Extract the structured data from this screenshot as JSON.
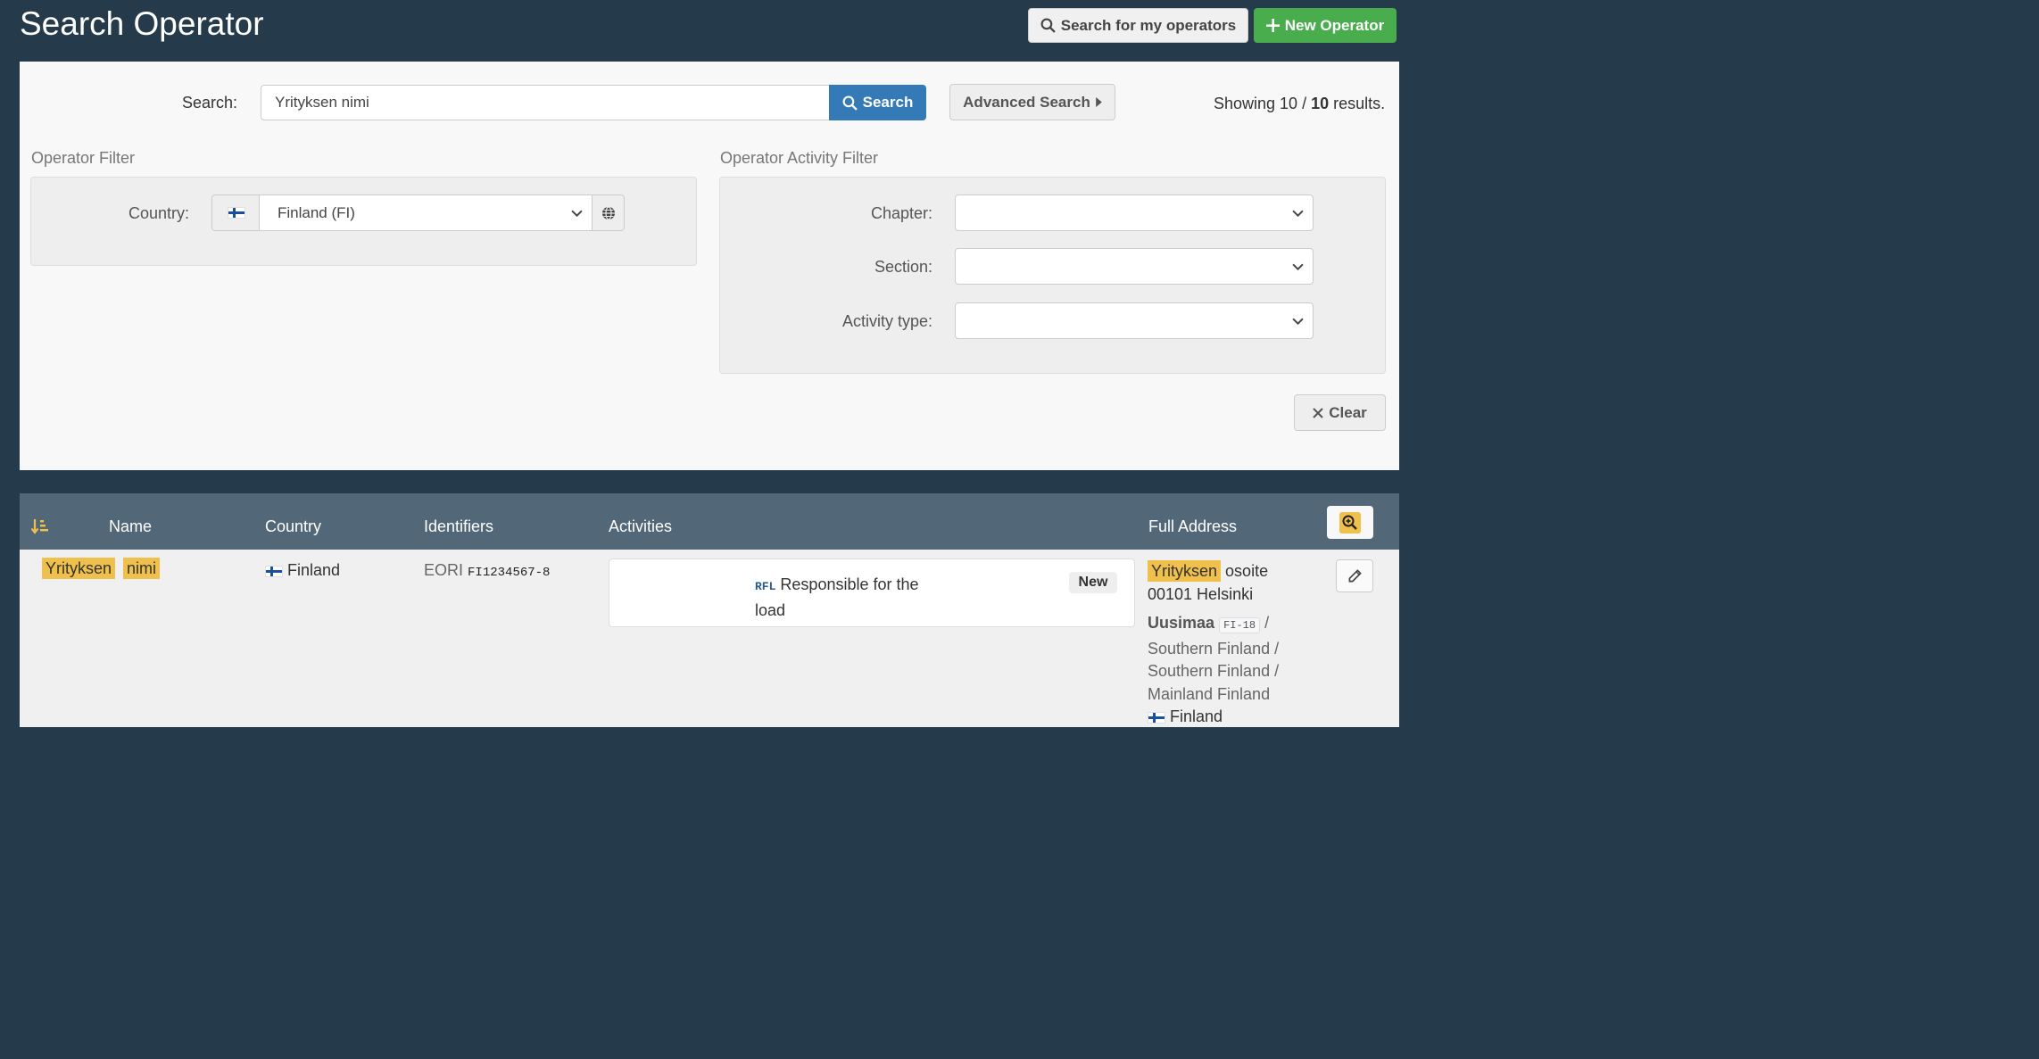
{
  "header": {
    "title": "Search Operator",
    "my_operators_label": "Search for my operators",
    "new_operator_label": "New Operator"
  },
  "search": {
    "label": "Search:",
    "value": "Yrityksen nimi",
    "button_label": "Search",
    "advanced_label": "Advanced Search",
    "results_prefix": "Showing 10 / ",
    "results_total": "10",
    "results_suffix": " results."
  },
  "operator_filter": {
    "title": "Operator Filter",
    "country_label": "Country:",
    "country_value": "Finland (FI)"
  },
  "activity_filter": {
    "title": "Operator Activity Filter",
    "chapter_label": "Chapter:",
    "section_label": "Section:",
    "activity_type_label": "Activity type:",
    "chapter_value": "",
    "section_value": "",
    "activity_type_value": ""
  },
  "clear_label": "Clear",
  "table": {
    "headers": {
      "name": "Name",
      "country": "Country",
      "identifiers": "Identifiers",
      "activities": "Activities",
      "address": "Full Address"
    },
    "rows": [
      {
        "name_part1": "Yrityksen",
        "name_part2": "nimi",
        "country": "Finland",
        "identifier_type": "EORI",
        "identifier_value": "FI1234567-8",
        "activity_code": "RFL",
        "activity_line1": "Responsible for the",
        "activity_line2": "load",
        "activity_badge": "New",
        "address_hl": "Yrityksen",
        "address_rest": "osoite",
        "address_line2": "00101 Helsinki",
        "region_name": "Uusimaa",
        "region_code": "FI-18",
        "region_sep": "/",
        "region_line2": "Southern Finland /",
        "region_line3": "Southern Finland /",
        "region_line4": "Mainland Finland",
        "address_country": "Finland"
      }
    ]
  },
  "icons": {
    "search": "search-icon",
    "plus": "plus-icon",
    "caret": "caret-right-icon",
    "globe": "globe-icon",
    "close": "close-icon",
    "sort": "sort-amount-icon",
    "zoom": "zoom-in-icon",
    "edit": "pencil-icon",
    "flag": "finland-flag-icon"
  },
  "colors": {
    "header_bg": "#253a4b",
    "primary": "#337ab7",
    "success": "#49ad4d",
    "highlight": "#f0c04c",
    "table_head": "#526878"
  }
}
